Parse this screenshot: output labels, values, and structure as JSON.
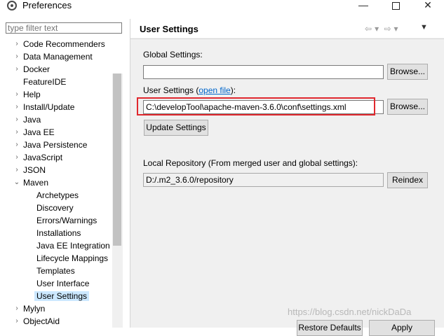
{
  "window": {
    "title": "Preferences",
    "minimize_glyph": "—",
    "close_glyph": "✕"
  },
  "filter": {
    "placeholder": "type filter text"
  },
  "tree": {
    "items": [
      {
        "label": "Code Recommenders",
        "expandable": true
      },
      {
        "label": "Data Management",
        "expandable": true
      },
      {
        "label": "Docker",
        "expandable": true
      },
      {
        "label": "FeatureIDE",
        "expandable": false
      },
      {
        "label": "Help",
        "expandable": true
      },
      {
        "label": "Install/Update",
        "expandable": true
      },
      {
        "label": "Java",
        "expandable": true
      },
      {
        "label": "Java EE",
        "expandable": true
      },
      {
        "label": "Java Persistence",
        "expandable": true
      },
      {
        "label": "JavaScript",
        "expandable": true
      },
      {
        "label": "JSON",
        "expandable": true
      },
      {
        "label": "Maven",
        "expandable": true,
        "expanded": true
      }
    ],
    "maven_children": [
      {
        "label": "Archetypes"
      },
      {
        "label": "Discovery"
      },
      {
        "label": "Errors/Warnings"
      },
      {
        "label": "Installations"
      },
      {
        "label": "Java EE Integration"
      },
      {
        "label": "Lifecycle Mappings"
      },
      {
        "label": "Templates"
      },
      {
        "label": "User Interface"
      },
      {
        "label": "User Settings",
        "selected": true
      }
    ],
    "after_items": [
      {
        "label": "Mylyn",
        "expandable": true
      },
      {
        "label": "ObjectAid",
        "expandable": true
      }
    ]
  },
  "page": {
    "title": "User Settings",
    "global_settings_label": "Global Settings:",
    "global_settings_value": "",
    "browse_label": "Browse...",
    "user_settings_label": "User Settings (",
    "open_file_link": "open file",
    "user_settings_label_end": "):",
    "user_settings_value": "C:\\developTool\\apache-maven-3.6.0\\conf\\settings.xml",
    "update_settings_label": "Update Settings",
    "local_repo_label": "Local Repository (From merged user and global settings):",
    "local_repo_value": "D:/.m2_3.6.0/repository",
    "reindex_label": "Reindex",
    "restore_defaults_label": "Restore Defaults",
    "apply_label": "Apply"
  },
  "icons": {
    "back": "⇦",
    "forward": "⇨",
    "dropdown": "▾",
    "view_menu": "▼",
    "collapsed": "›",
    "expanded": "⌄"
  },
  "watermark": "https://blog.csdn.net/nickDaDa"
}
